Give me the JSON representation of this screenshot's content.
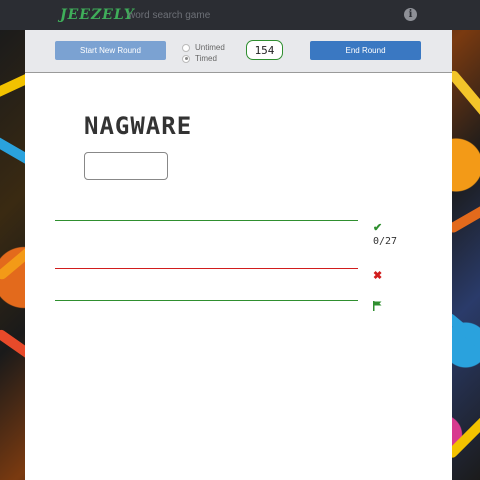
{
  "header": {
    "logo": "JEEZELY",
    "tagline": "word search game",
    "info_icon": "info-icon"
  },
  "toolbar": {
    "start_label": "Start New Round",
    "mode_options": [
      {
        "label": "Untimed",
        "selected": false
      },
      {
        "label": "Timed",
        "selected": true
      }
    ],
    "timer_value": "154",
    "end_label": "End Round"
  },
  "game": {
    "word": "NAGWARE",
    "guess_value": "",
    "found": {
      "count": "0/27",
      "icon": "check-icon",
      "color": "#2f8f2f"
    },
    "wrong": {
      "icon": "cross-icon",
      "color": "#d11d1d"
    },
    "missed": {
      "icon": "flag-icon",
      "color": "#2f8f2f"
    }
  }
}
